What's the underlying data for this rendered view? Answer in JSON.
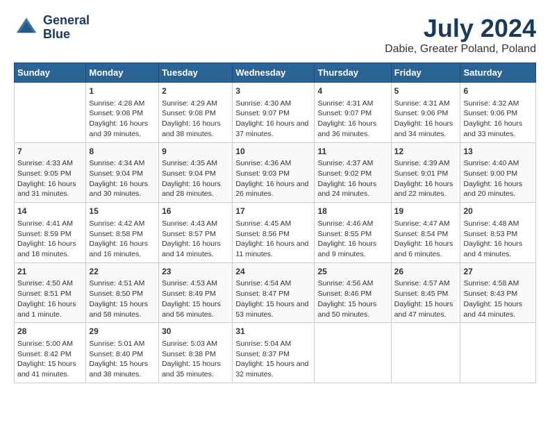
{
  "header": {
    "logo_line1": "General",
    "logo_line2": "Blue",
    "month_year": "July 2024",
    "location": "Dabie, Greater Poland, Poland"
  },
  "days_of_week": [
    "Sunday",
    "Monday",
    "Tuesday",
    "Wednesday",
    "Thursday",
    "Friday",
    "Saturday"
  ],
  "weeks": [
    [
      {
        "day": "",
        "content": ""
      },
      {
        "day": "1",
        "content": "Sunrise: 4:28 AM\nSunset: 9:08 PM\nDaylight: 16 hours and 39 minutes."
      },
      {
        "day": "2",
        "content": "Sunrise: 4:29 AM\nSunset: 9:08 PM\nDaylight: 16 hours and 38 minutes."
      },
      {
        "day": "3",
        "content": "Sunrise: 4:30 AM\nSunset: 9:07 PM\nDaylight: 16 hours and 37 minutes."
      },
      {
        "day": "4",
        "content": "Sunrise: 4:31 AM\nSunset: 9:07 PM\nDaylight: 16 hours and 36 minutes."
      },
      {
        "day": "5",
        "content": "Sunrise: 4:31 AM\nSunset: 9:06 PM\nDaylight: 16 hours and 34 minutes."
      },
      {
        "day": "6",
        "content": "Sunrise: 4:32 AM\nSunset: 9:06 PM\nDaylight: 16 hours and 33 minutes."
      }
    ],
    [
      {
        "day": "7",
        "content": "Sunrise: 4:33 AM\nSunset: 9:05 PM\nDaylight: 16 hours and 31 minutes."
      },
      {
        "day": "8",
        "content": "Sunrise: 4:34 AM\nSunset: 9:04 PM\nDaylight: 16 hours and 30 minutes."
      },
      {
        "day": "9",
        "content": "Sunrise: 4:35 AM\nSunset: 9:04 PM\nDaylight: 16 hours and 28 minutes."
      },
      {
        "day": "10",
        "content": "Sunrise: 4:36 AM\nSunset: 9:03 PM\nDaylight: 16 hours and 26 minutes."
      },
      {
        "day": "11",
        "content": "Sunrise: 4:37 AM\nSunset: 9:02 PM\nDaylight: 16 hours and 24 minutes."
      },
      {
        "day": "12",
        "content": "Sunrise: 4:39 AM\nSunset: 9:01 PM\nDaylight: 16 hours and 22 minutes."
      },
      {
        "day": "13",
        "content": "Sunrise: 4:40 AM\nSunset: 9:00 PM\nDaylight: 16 hours and 20 minutes."
      }
    ],
    [
      {
        "day": "14",
        "content": "Sunrise: 4:41 AM\nSunset: 8:59 PM\nDaylight: 16 hours and 18 minutes."
      },
      {
        "day": "15",
        "content": "Sunrise: 4:42 AM\nSunset: 8:58 PM\nDaylight: 16 hours and 16 minutes."
      },
      {
        "day": "16",
        "content": "Sunrise: 4:43 AM\nSunset: 8:57 PM\nDaylight: 16 hours and 14 minutes."
      },
      {
        "day": "17",
        "content": "Sunrise: 4:45 AM\nSunset: 8:56 PM\nDaylight: 16 hours and 11 minutes."
      },
      {
        "day": "18",
        "content": "Sunrise: 4:46 AM\nSunset: 8:55 PM\nDaylight: 16 hours and 9 minutes."
      },
      {
        "day": "19",
        "content": "Sunrise: 4:47 AM\nSunset: 8:54 PM\nDaylight: 16 hours and 6 minutes."
      },
      {
        "day": "20",
        "content": "Sunrise: 4:48 AM\nSunset: 8:53 PM\nDaylight: 16 hours and 4 minutes."
      }
    ],
    [
      {
        "day": "21",
        "content": "Sunrise: 4:50 AM\nSunset: 8:51 PM\nDaylight: 16 hours and 1 minute."
      },
      {
        "day": "22",
        "content": "Sunrise: 4:51 AM\nSunset: 8:50 PM\nDaylight: 15 hours and 58 minutes."
      },
      {
        "day": "23",
        "content": "Sunrise: 4:53 AM\nSunset: 8:49 PM\nDaylight: 15 hours and 56 minutes."
      },
      {
        "day": "24",
        "content": "Sunrise: 4:54 AM\nSunset: 8:47 PM\nDaylight: 15 hours and 53 minutes."
      },
      {
        "day": "25",
        "content": "Sunrise: 4:56 AM\nSunset: 8:46 PM\nDaylight: 15 hours and 50 minutes."
      },
      {
        "day": "26",
        "content": "Sunrise: 4:57 AM\nSunset: 8:45 PM\nDaylight: 15 hours and 47 minutes."
      },
      {
        "day": "27",
        "content": "Sunrise: 4:58 AM\nSunset: 8:43 PM\nDaylight: 15 hours and 44 minutes."
      }
    ],
    [
      {
        "day": "28",
        "content": "Sunrise: 5:00 AM\nSunset: 8:42 PM\nDaylight: 15 hours and 41 minutes."
      },
      {
        "day": "29",
        "content": "Sunrise: 5:01 AM\nSunset: 8:40 PM\nDaylight: 15 hours and 38 minutes."
      },
      {
        "day": "30",
        "content": "Sunrise: 5:03 AM\nSunset: 8:38 PM\nDaylight: 15 hours and 35 minutes."
      },
      {
        "day": "31",
        "content": "Sunrise: 5:04 AM\nSunset: 8:37 PM\nDaylight: 15 hours and 32 minutes."
      },
      {
        "day": "",
        "content": ""
      },
      {
        "day": "",
        "content": ""
      },
      {
        "day": "",
        "content": ""
      }
    ]
  ]
}
